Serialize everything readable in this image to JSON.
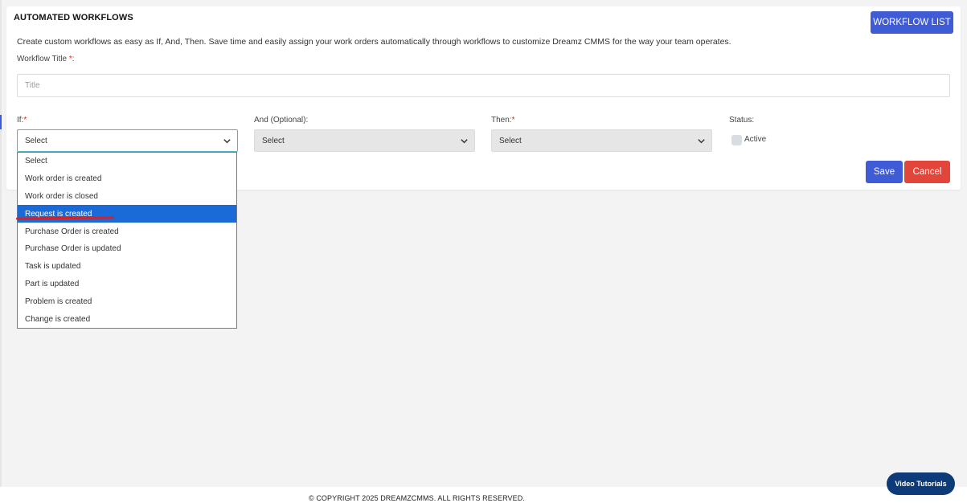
{
  "header": {
    "title": "AUTOMATED WORKFLOWS",
    "workflow_list_label": "WORKFLOW LIST"
  },
  "description": "Create custom workflows as easy as If, And, Then. Save time and easily assign your work orders automatically through workflows to customize Dreamz CMMS for the way your team operates.",
  "form": {
    "workflow_title_label": "Workflow Title",
    "required_mark": "*",
    "required_mark_colon": "*:",
    "title_placeholder": "Title",
    "if_label": "If:",
    "and_label": "And (Optional):",
    "then_label": "Then:",
    "status_label": "Status:",
    "if_value": "Select",
    "and_value": "Select",
    "then_value": "Select",
    "active_label": "Active",
    "active_checked": false,
    "save_label": "Save",
    "cancel_label": "Cancel"
  },
  "if_dropdown": {
    "options": [
      "Select",
      "Work order is created",
      "Work order is closed",
      "Request is created",
      "Purchase Order is created",
      "Purchase Order is updated",
      "Task is updated",
      "Part is updated",
      "Problem is created",
      "Change is created"
    ],
    "highlighted": "Request is created"
  },
  "footer": {
    "copyright": "© COPYRIGHT 2025 DREAMZCMMS. ALL RIGHTS RESERVED.",
    "video_tutorials_label": "Video Tutorials"
  },
  "colors": {
    "primary": "#3f5bd6",
    "danger": "#e2453a",
    "highlight": "#1a6bd8",
    "footer_button": "#0d3a78"
  }
}
